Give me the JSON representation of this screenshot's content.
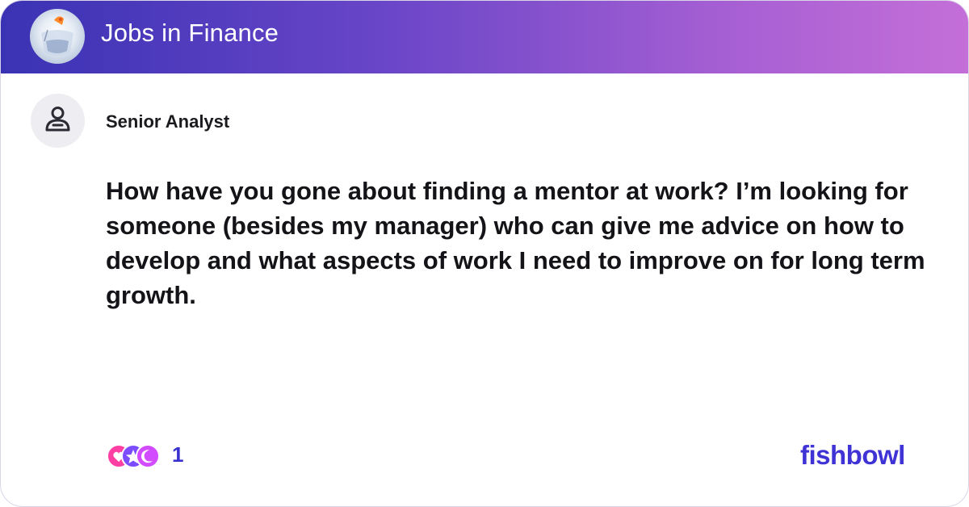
{
  "header": {
    "title": "Jobs in Finance",
    "icon": "fishbowl-icon"
  },
  "post": {
    "author_title": "Senior Analyst",
    "avatar_icon": "user-icon",
    "body": "How have you gone about finding a mentor at work? I’m looking for someone (besides my manager) who can give me advice on how to develop and what aspects of work I need to improve on for long term growth."
  },
  "footer": {
    "reaction_count": "1",
    "reaction_icons": [
      "heart-reaction-icon",
      "star-reaction-icon",
      "moon-reaction-icon"
    ],
    "brand": "fishbowl"
  },
  "colors": {
    "header_gradient_start": "#3a32b4",
    "header_gradient_end": "#c46fd8",
    "brand": "#3f33d6",
    "count": "#3a32d0"
  }
}
